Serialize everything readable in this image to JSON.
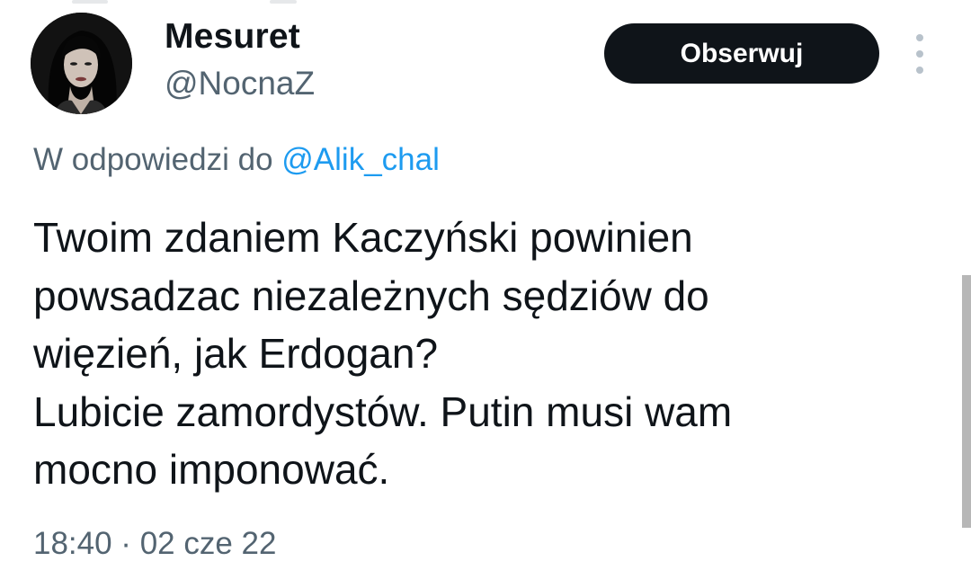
{
  "tweet": {
    "author": {
      "display_name": "Mesuret",
      "handle": "@NocnaZ"
    },
    "follow_button_label": "Obserwuj",
    "more_icon": "more-vertical-icon",
    "reply_context": {
      "prefix": "W odpowiedzi do",
      "mention": "@Alik_chal"
    },
    "text_lines": [
      "Twoim zdaniem Kaczyński powinien",
      "powsadzac niezależnych sędziów do",
      "więzień, jak Erdogan?",
      "Lubicie zamordystów. Putin musi wam",
      "mocno imponować."
    ],
    "timestamp": "18:40 · 02 cze 22"
  },
  "colors": {
    "text_primary": "#0f1419",
    "text_secondary": "#536471",
    "link": "#1d9bf0",
    "button_bg": "#0f1419",
    "button_text": "#ffffff"
  }
}
